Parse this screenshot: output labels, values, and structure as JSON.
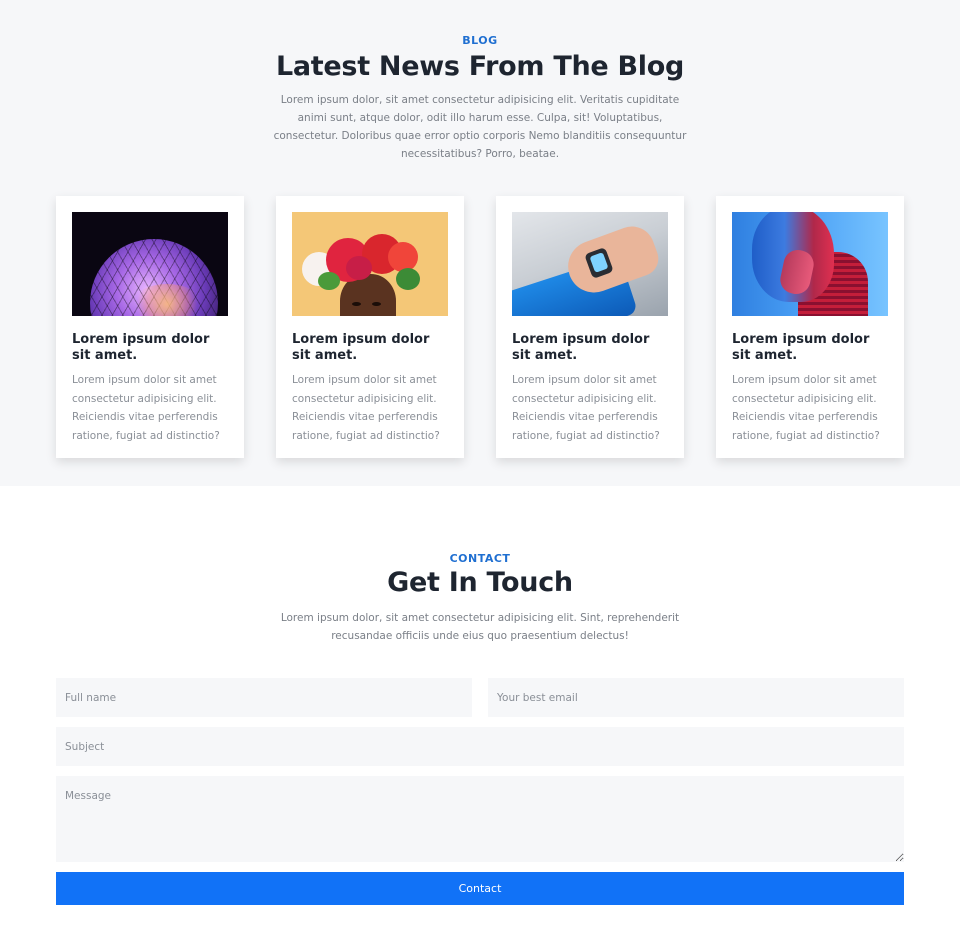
{
  "blog": {
    "eyebrow": "BLOG",
    "title": "Latest News From The Blog",
    "description": "Lorem ipsum dolor, sit amet consectetur adipisicing elit. Veritatis cupiditate animi sunt, atque dolor, odit illo harum esse. Culpa, sit! Voluptatibus, consectetur. Doloribus quae error optio corporis Nemo blanditiis consequuntur necessitatibus? Porro, beatae.",
    "posts": [
      {
        "image": "glowing-sphere-image",
        "title": "Lorem ipsum dolor sit amet.",
        "excerpt": "Lorem ipsum dolor sit amet consectetur adipisicing elit. Reiciendis vitae perferendis ratione, fugiat ad distinctio?"
      },
      {
        "image": "flower-crown-portrait-image",
        "title": "Lorem ipsum dolor sit amet.",
        "excerpt": "Lorem ipsum dolor sit amet consectetur adipisicing elit. Reiciendis vitae perferendis ratione, fugiat ad distinctio?"
      },
      {
        "image": "smartwatch-wrist-image",
        "title": "Lorem ipsum dolor sit amet.",
        "excerpt": "Lorem ipsum dolor sit amet consectetur adipisicing elit. Reiciendis vitae perferendis ratione, fugiat ad distinctio?"
      },
      {
        "image": "neon-portrait-image",
        "title": "Lorem ipsum dolor sit amet.",
        "excerpt": "Lorem ipsum dolor sit amet consectetur adipisicing elit. Reiciendis vitae perferendis ratione, fugiat ad distinctio?"
      }
    ]
  },
  "contact": {
    "eyebrow": "CONTACT",
    "title": "Get In Touch",
    "description": "Lorem ipsum dolor, sit amet consectetur adipisicing elit. Sint, reprehenderit recusandae officiis unde eius quo praesentium delectus!",
    "fullname_placeholder": "Full name",
    "email_placeholder": "Your best email",
    "subject_placeholder": "Subject",
    "message_placeholder": "Message",
    "submit_label": "Contact"
  },
  "colors": {
    "accent": "#1172f7",
    "eyebrow": "#1f6fd1",
    "section_bg": "#f6f7f9"
  }
}
